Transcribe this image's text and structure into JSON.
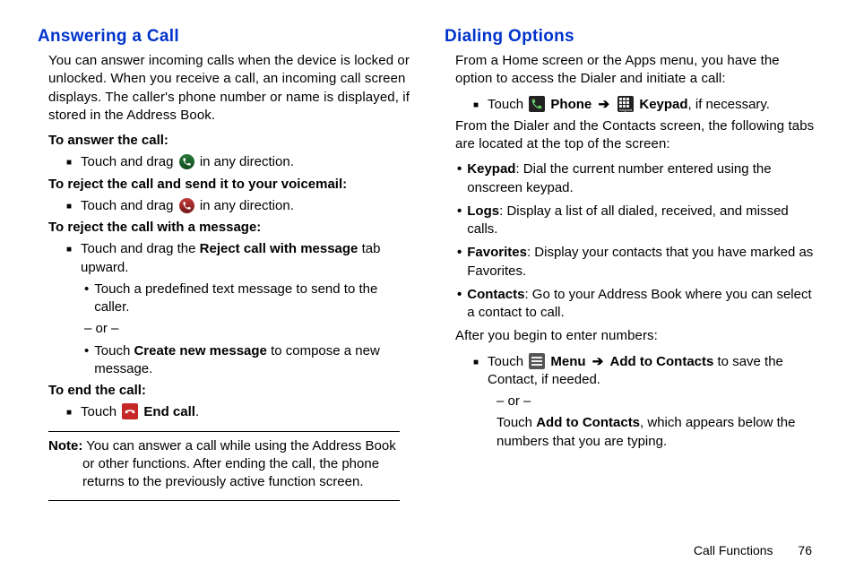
{
  "left": {
    "heading": "Answering a Call",
    "intro": "You can answer incoming calls when the device is locked or unlocked. When you receive a call, an incoming call screen displays. The caller's phone number or name is displayed, if stored in the Address Book.",
    "sub1": "To answer the call:",
    "sub1_item_pre": "Touch and drag",
    "sub1_item_post": "in any direction.",
    "sub2": "To reject the call and send it to your voicemail:",
    "sub2_item_pre": "Touch and drag",
    "sub2_item_post": "in any direction.",
    "sub3": "To reject the call with a message:",
    "sub3_item_pre": "Touch and drag the",
    "sub3_item_bold": "Reject call with message",
    "sub3_item_post": "tab upward.",
    "sub3_dot1": "Touch a predefined text message to send to the caller.",
    "sub3_or": "– or –",
    "sub3_dot2_pre": "Touch",
    "sub3_dot2_bold": "Create new message",
    "sub3_dot2_post": "to compose a new message.",
    "sub4": "To end the call:",
    "sub4_item_pre": "Touch",
    "sub4_item_bold": "End call",
    "sub4_item_post": ".",
    "note_label": "Note:",
    "note_text": "You can answer a call while using the Address Book or other functions. After ending the call, the phone returns to the previously active function screen."
  },
  "right": {
    "heading": "Dialing Options",
    "intro": "From a Home screen or the Apps menu, you have the option to access the Dialer and initiate a call:",
    "r1_pre": "Touch",
    "r1_bold1": "Phone",
    "r1_arrow": "➔",
    "r1_bold2": "Keypad",
    "r1_post": ", if necessary.",
    "para2": "From the Dialer and the Contacts screen, the following tabs are located at the top of the screen:",
    "bul1_bold": "Keypad",
    "bul1_text": ": Dial the current number entered using the onscreen keypad.",
    "bul2_bold": "Logs",
    "bul2_text": ": Display a list of all dialed, received, and missed calls.",
    "bul3_bold": "Favorites",
    "bul3_text": ": Display your contacts that you have marked as Favorites.",
    "bul4_bold": "Contacts",
    "bul4_text": ": Go to your Address Book where you can select a contact to call.",
    "para3": "After you begin to enter numbers:",
    "r2_pre": "Touch",
    "r2_bold1": "Menu",
    "r2_arrow": "➔",
    "r2_bold2": "Add to Contacts",
    "r2_post": "to save the Contact, if needed.",
    "r2_or": "– or –",
    "r2_line2_pre": "Touch",
    "r2_line2_bold": "Add to Contacts",
    "r2_line2_post": ", which appears below the numbers that you are typing."
  },
  "footer": {
    "section": "Call Functions",
    "page": "76"
  }
}
